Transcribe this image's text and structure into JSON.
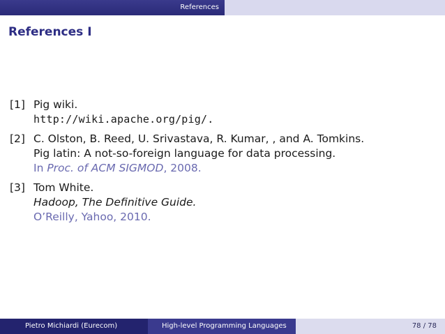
{
  "header": {
    "section_label": "References"
  },
  "frame": {
    "title": "References I"
  },
  "references": [
    {
      "number": "[1]",
      "lines": {
        "author": "Pig wiki.",
        "url": "http://wiki.apache.org/pig/."
      }
    },
    {
      "number": "[2]",
      "lines": {
        "author": "C. Olston, B. Reed, U. Srivastava, R. Kumar, , and A. Tomkins.",
        "title": "Pig latin: A not-so-foreign language for data processing.",
        "venue_prefix": "In ",
        "venue": "Proc. of ACM SIGMOD",
        "venue_suffix": ", 2008."
      }
    },
    {
      "number": "[3]",
      "lines": {
        "author": "Tom White.",
        "title": "Hadoop, The Definitive Guide.",
        "publisher": "O’Reilly, Yahoo, 2010."
      }
    }
  ],
  "footer": {
    "author": "Pietro Michiardi  (Eurecom)",
    "talk_title": "High-level Programming Languages",
    "page": "78 / 78"
  }
}
